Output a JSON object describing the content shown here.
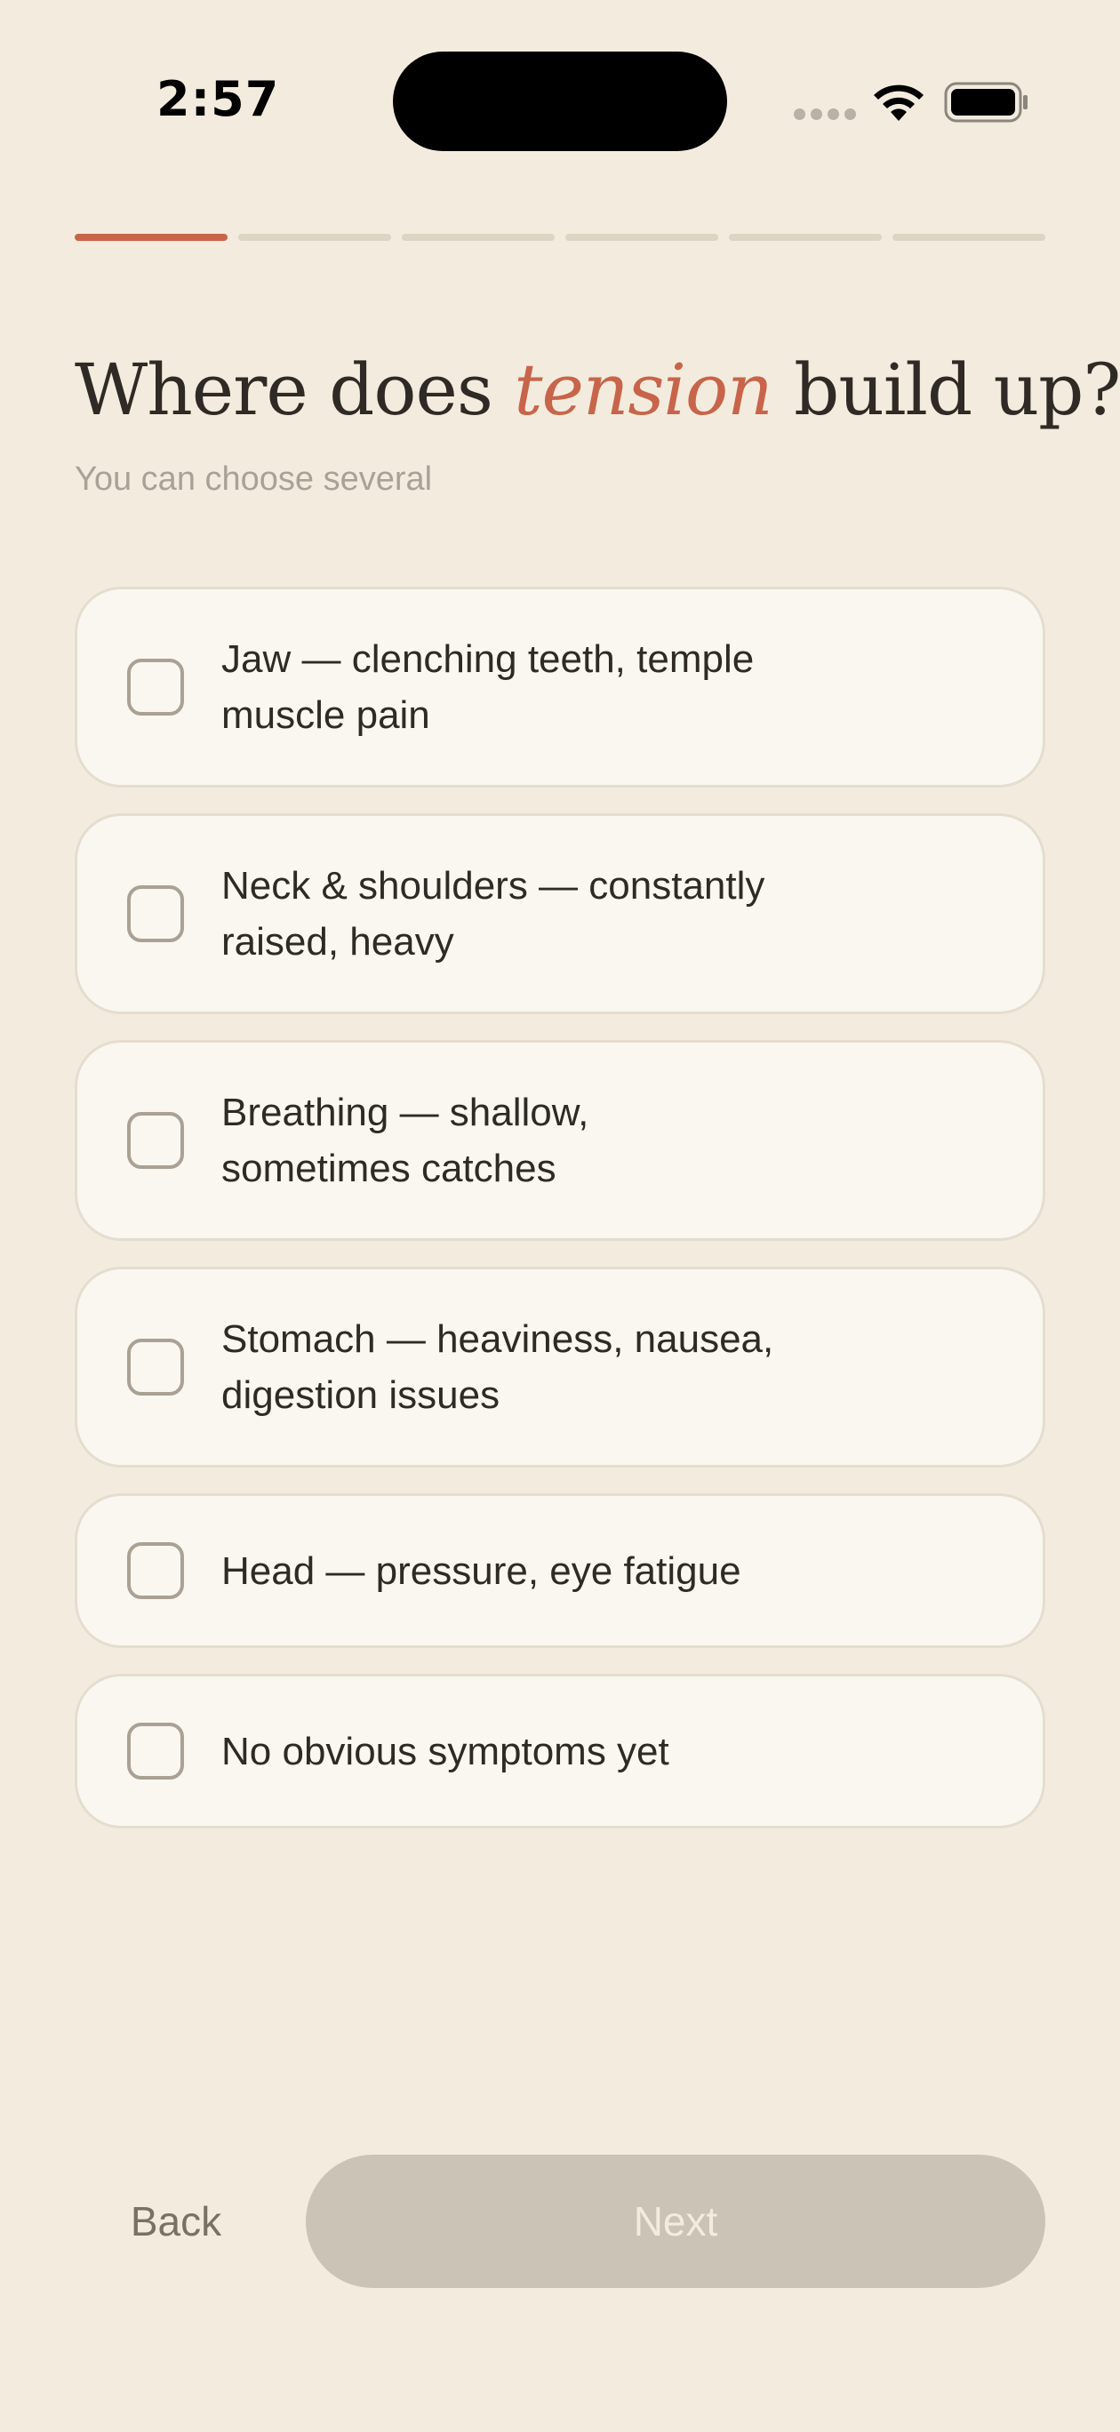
{
  "status_bar": {
    "time": "2:57"
  },
  "progress": {
    "total_steps": 6,
    "current_step": 1,
    "active_color": "#c8644a",
    "inactive_color": "#ddd4c4"
  },
  "header": {
    "title_before": "Where does",
    "title_accent": "tension",
    "title_after": "build up?",
    "subtitle": "You can choose several"
  },
  "options": [
    {
      "label": "Jaw — clenching teeth, temple muscle pain",
      "checked": false
    },
    {
      "label": "Neck & shoulders — constantly raised, heavy",
      "checked": false
    },
    {
      "label": "Breathing — shallow, sometimes catches",
      "checked": false
    },
    {
      "label": "Stomach — heaviness, nausea, digestion issues",
      "checked": false
    },
    {
      "label": "Head — pressure, eye fatigue",
      "checked": false
    },
    {
      "label": "No obvious symptoms yet",
      "checked": false
    }
  ],
  "footer": {
    "back_label": "Back",
    "next_label": "Next",
    "next_enabled": false
  },
  "colors": {
    "background": "#f3ecde",
    "accent": "#c8644a",
    "card": "#faf7f0",
    "disabled_button": "#cbc3b5"
  }
}
